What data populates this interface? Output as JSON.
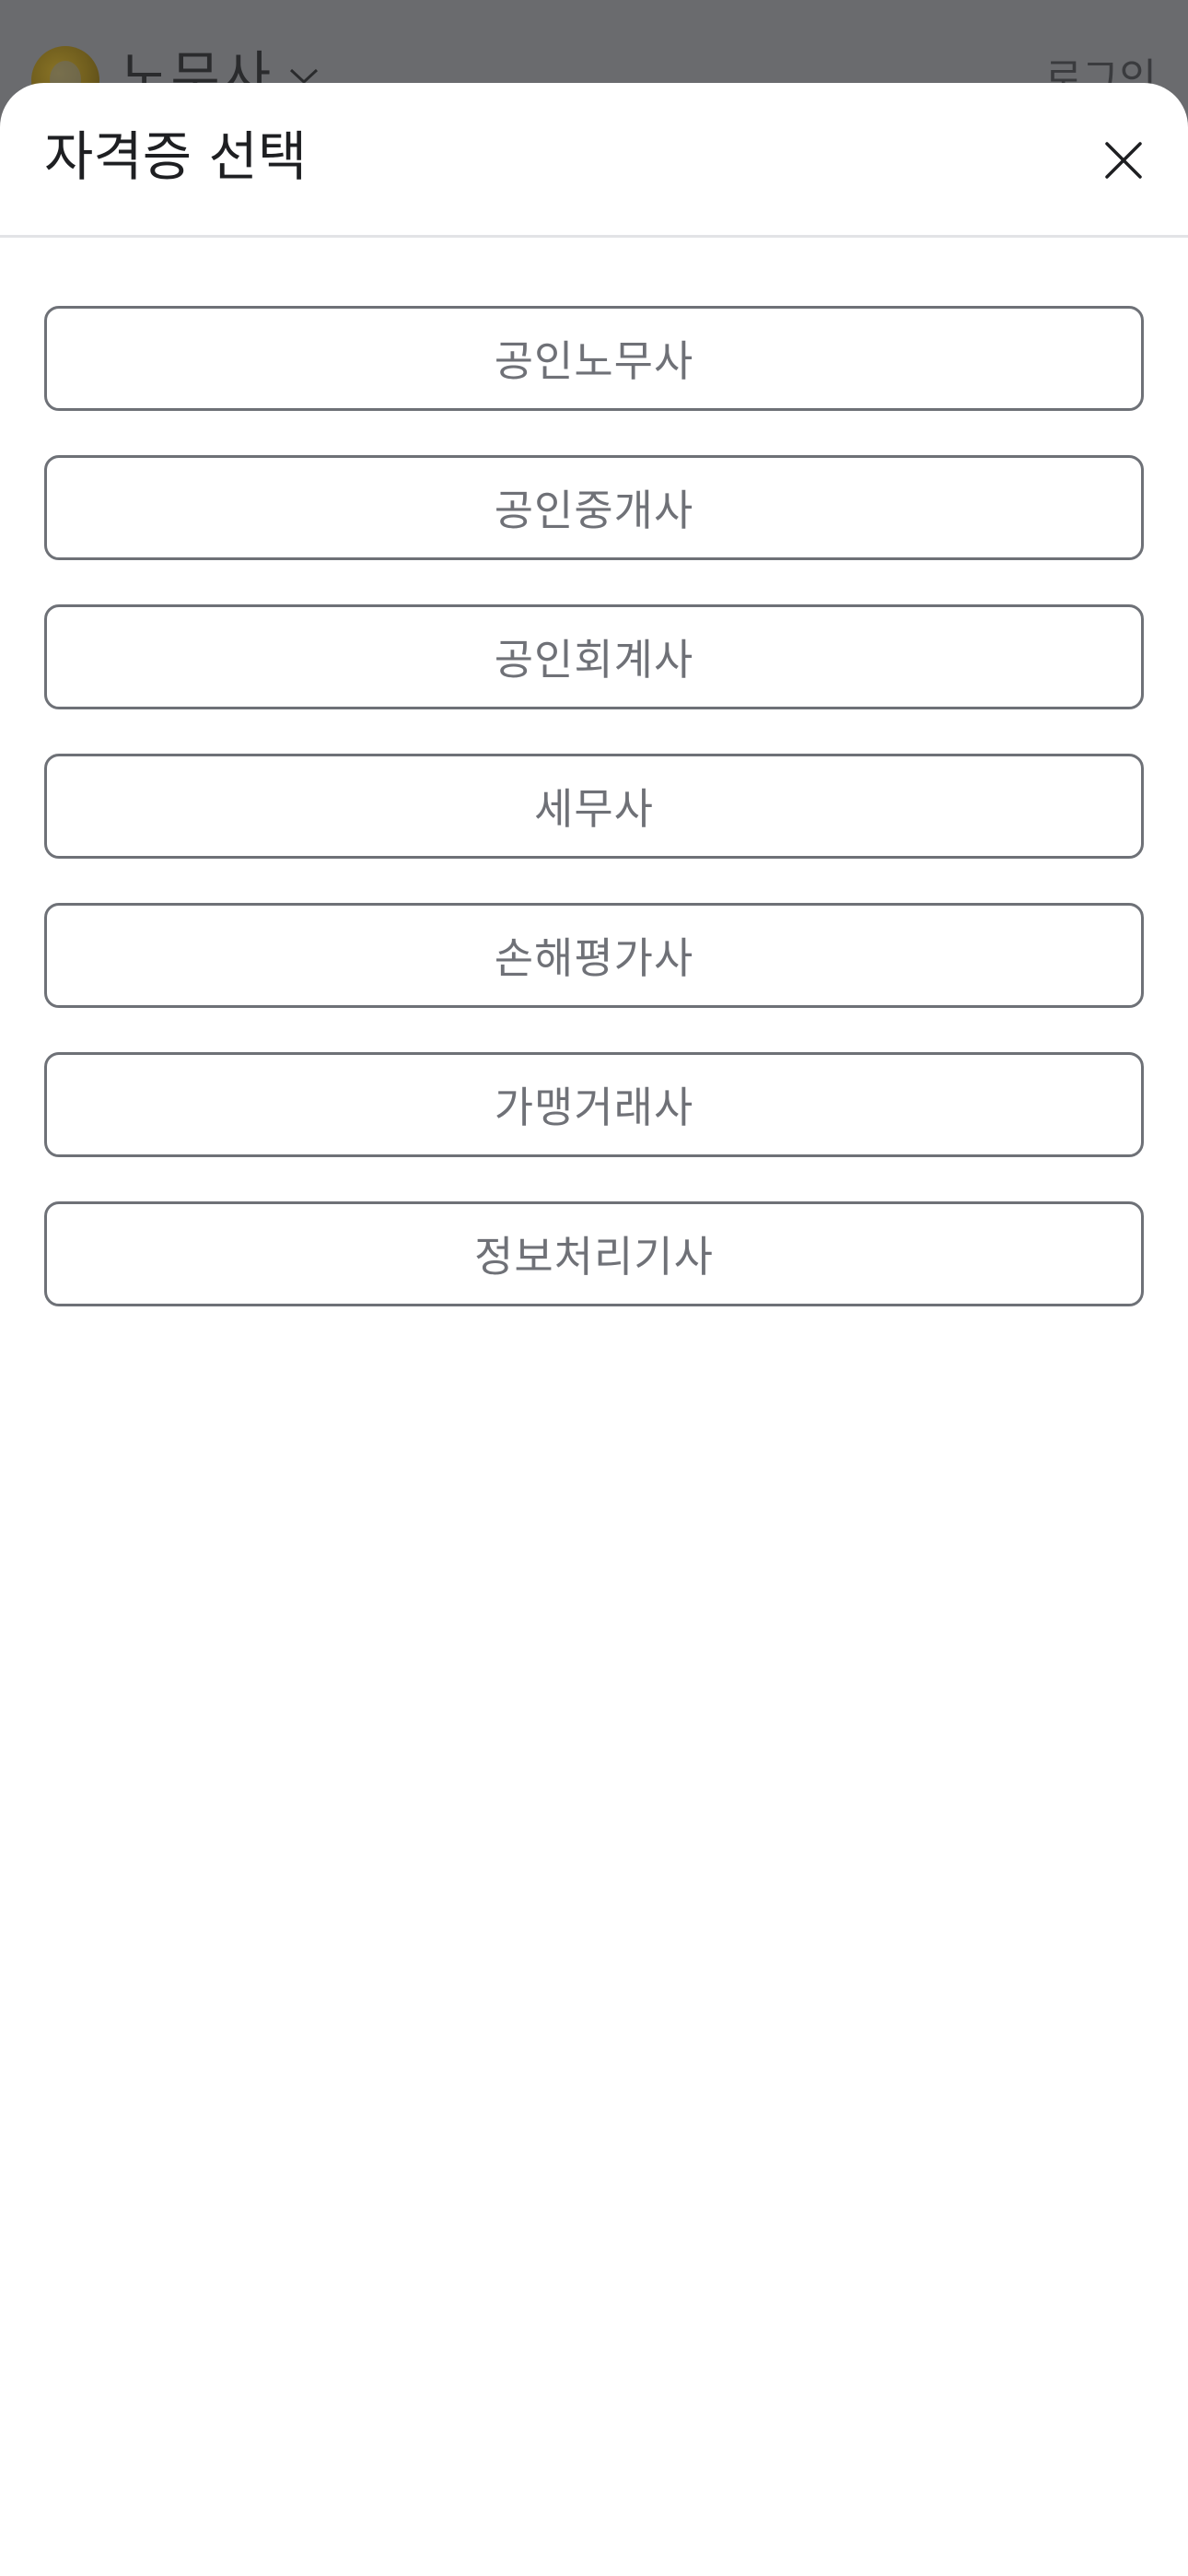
{
  "background": {
    "title": "노무사",
    "login_label": "로그인"
  },
  "sheet": {
    "title": "자격증 선택",
    "close_icon": "close-icon",
    "options": [
      {
        "label": "공인노무사"
      },
      {
        "label": "공인중개사"
      },
      {
        "label": "공인회계사"
      },
      {
        "label": "세무사"
      },
      {
        "label": "손해평가사"
      },
      {
        "label": "가맹거래사"
      },
      {
        "label": "정보처리기사"
      }
    ]
  },
  "colors": {
    "overlay": "#6a6b6e",
    "option_border": "#6e7177",
    "option_text": "#6f7177",
    "title_text": "#1e1f22"
  }
}
